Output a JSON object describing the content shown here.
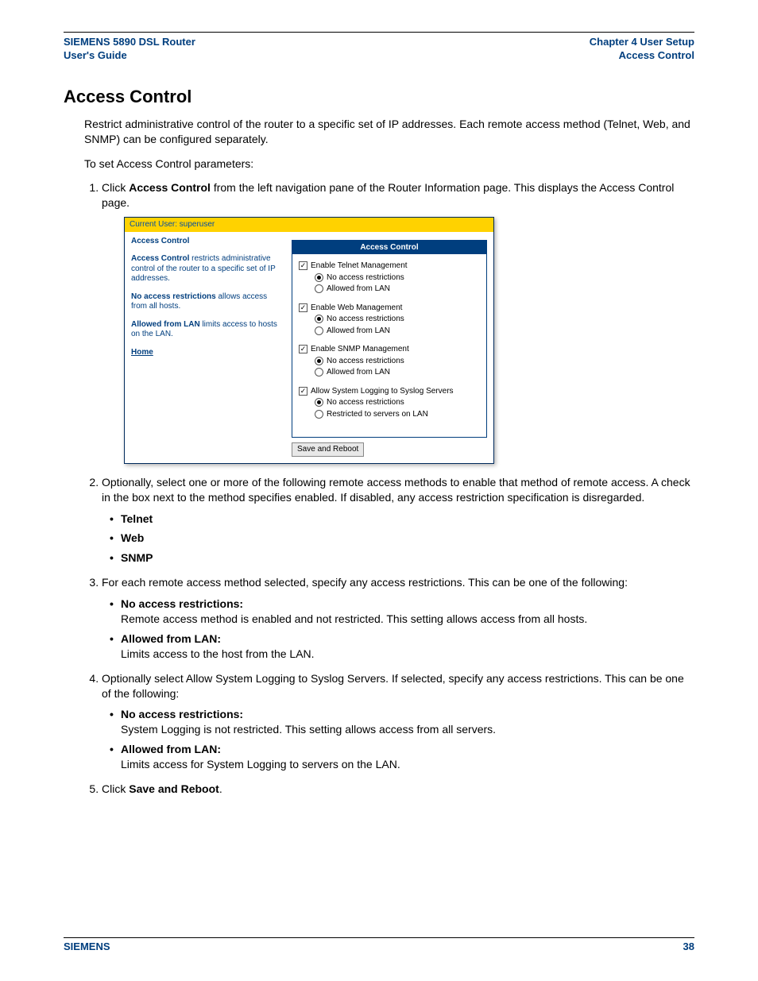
{
  "header": {
    "leftLine1": "SIEMENS 5890 DSL Router",
    "leftLine2": "User's Guide",
    "rightLine1": "Chapter 4  User Setup",
    "rightLine2": "Access Control"
  },
  "sectionTitle": "Access Control",
  "intro1": "Restrict administrative control of the router to a specific set of IP addresses. Each remote access method (Telnet, Web, and SNMP) can be configured separately.",
  "intro2": "To set Access Control parameters:",
  "step1_a": "Click ",
  "step1_b": "Access Control",
  "step1_c": " from the left navigation pane of the Router Information page. This displays the Access Control page.",
  "shot": {
    "userbar": "Current User: superuser",
    "leftTitle": "Access Control",
    "p1_b": "Access Control",
    "p1_r": " restricts administrative control of the router to a specific set of IP addresses.",
    "p2_b": "No access restrictions",
    "p2_r": " allows access from all hosts.",
    "p3_b": "Allowed from LAN",
    "p3_r": " limits access to hosts on the LAN.",
    "home": "Home",
    "panelTitle": "Access Control",
    "groups": [
      {
        "cb": "Enable Telnet Management",
        "r1": "No access restrictions",
        "r2": "Allowed from LAN"
      },
      {
        "cb": "Enable Web Management",
        "r1": "No access restrictions",
        "r2": "Allowed from LAN"
      },
      {
        "cb": "Enable SNMP Management",
        "r1": "No access restrictions",
        "r2": "Allowed from LAN"
      },
      {
        "cb": "Allow System Logging to Syslog Servers",
        "r1": "No access restrictions",
        "r2": "Restricted to servers on LAN"
      }
    ],
    "button": "Save and Reboot"
  },
  "step2": "Optionally, select one or more of the following remote access methods to enable that method of remote access. A check in the box next to the method specifies enabled. If disabled, any access restriction specification is disregarded.",
  "step2_bullets": [
    "Telnet",
    "Web",
    "SNMP"
  ],
  "step3": "For each remote access method selected, specify any access restrictions. This can be one of the following:",
  "step3_bullets": [
    {
      "t": "No access restrictions:",
      "d": "Remote access method is enabled and not restricted. This setting allows access from all hosts."
    },
    {
      "t": "Allowed from LAN:",
      "d": "Limits access to the host from the LAN."
    }
  ],
  "step4": "Optionally select Allow System Logging to Syslog Servers. If selected, specify any access restrictions. This can be one of the following:",
  "step4_bullets": [
    {
      "t": "No access restrictions:",
      "d": "System Logging is not restricted. This setting allows access from all servers."
    },
    {
      "t": "Allowed from LAN:",
      "d": "Limits access for System Logging to servers on the LAN."
    }
  ],
  "step5_a": "Click ",
  "step5_b": "Save and Reboot",
  "step5_c": ".",
  "footer": {
    "left": "SIEMENS",
    "right": "38"
  }
}
